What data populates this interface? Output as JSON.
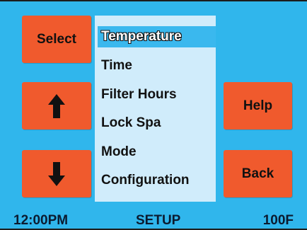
{
  "buttons": {
    "select_label": "Select",
    "up_icon": "arrow-up-icon",
    "down_icon": "arrow-down-icon",
    "help_label": "Help",
    "back_label": "Back"
  },
  "menu": {
    "items": [
      {
        "label": "Temperature",
        "selected": true
      },
      {
        "label": "Time",
        "selected": false
      },
      {
        "label": "Filter Hours",
        "selected": false
      },
      {
        "label": "Lock Spa",
        "selected": false
      },
      {
        "label": "Mode",
        "selected": false
      },
      {
        "label": "Configuration",
        "selected": false
      }
    ]
  },
  "status": {
    "time": "12:00PM",
    "mode": "SETUP",
    "temperature": "100F"
  },
  "colors": {
    "background": "#30b6ec",
    "button": "#f05a2d",
    "menu_background": "#d0ecfb",
    "selected_highlight": "#3ab8ee"
  }
}
